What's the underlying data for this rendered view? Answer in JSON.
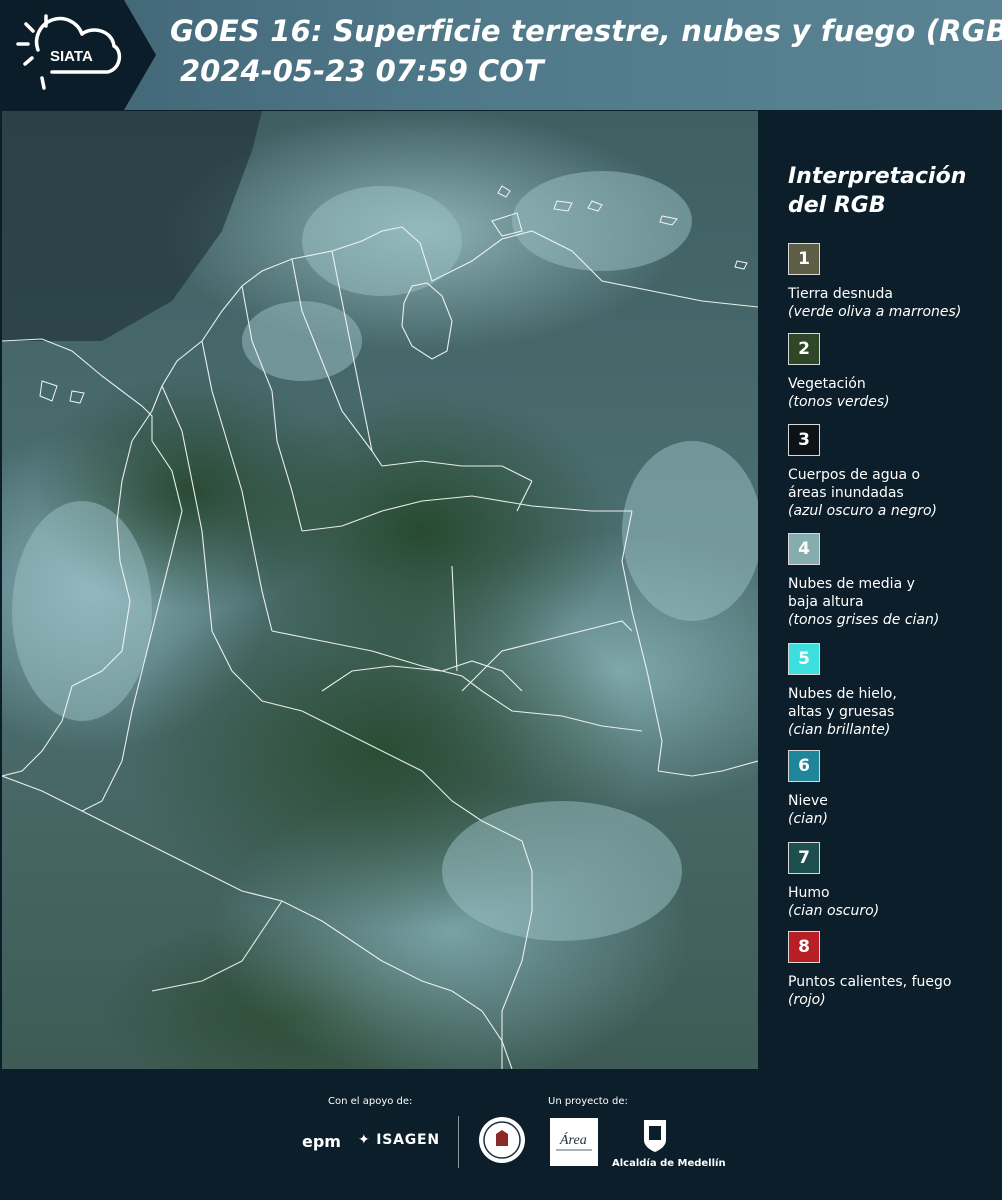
{
  "header": {
    "logo_text": "SIATA",
    "title_line1": "GOES 16: Superficie terrestre, nubes y fuego (RGB)",
    "title_line2": "2024-05-23 07:59 COT"
  },
  "map": {
    "image_semantic": "goes16-rgb-satellite-image-colombia"
  },
  "legend": {
    "title": "Interpretación del RGB",
    "items": [
      {
        "number": "1",
        "color": "#5e5d45",
        "label": "Tierra desnuda",
        "desc": "(verde oliva a marrones)"
      },
      {
        "number": "2",
        "color": "#2f4726",
        "label": "Vegetación",
        "desc": "(tonos verdes)"
      },
      {
        "number": "3",
        "color": "#0c1216",
        "label": "Cuerpos de agua o áreas inundadas",
        "desc": "(azul oscuro a negro)"
      },
      {
        "number": "4",
        "color": "#86adad",
        "label": "Nubes de media y baja altura",
        "desc": "(tonos grises de cian)"
      },
      {
        "number": "5",
        "color": "#3cdede",
        "label": "Nubes de hielo, altas y gruesas",
        "desc": "(cian brillante)"
      },
      {
        "number": "6",
        "color": "#1f8598",
        "label": "Nieve",
        "desc": "(cian)"
      },
      {
        "number": "7",
        "color": "#1e4f4f",
        "label": "Humo",
        "desc": "(cian oscuro)"
      },
      {
        "number": "8",
        "color": "#b71f24",
        "label": "Puntos calientes, fuego",
        "desc": "(rojo)"
      }
    ]
  },
  "footer": {
    "support_label": "Con el apoyo de:",
    "project_label": "Un proyecto de:",
    "epm": "epm",
    "isagen": "ISAGEN",
    "area_text": "Área",
    "alcaldia": "Alcaldía de Medellín"
  }
}
